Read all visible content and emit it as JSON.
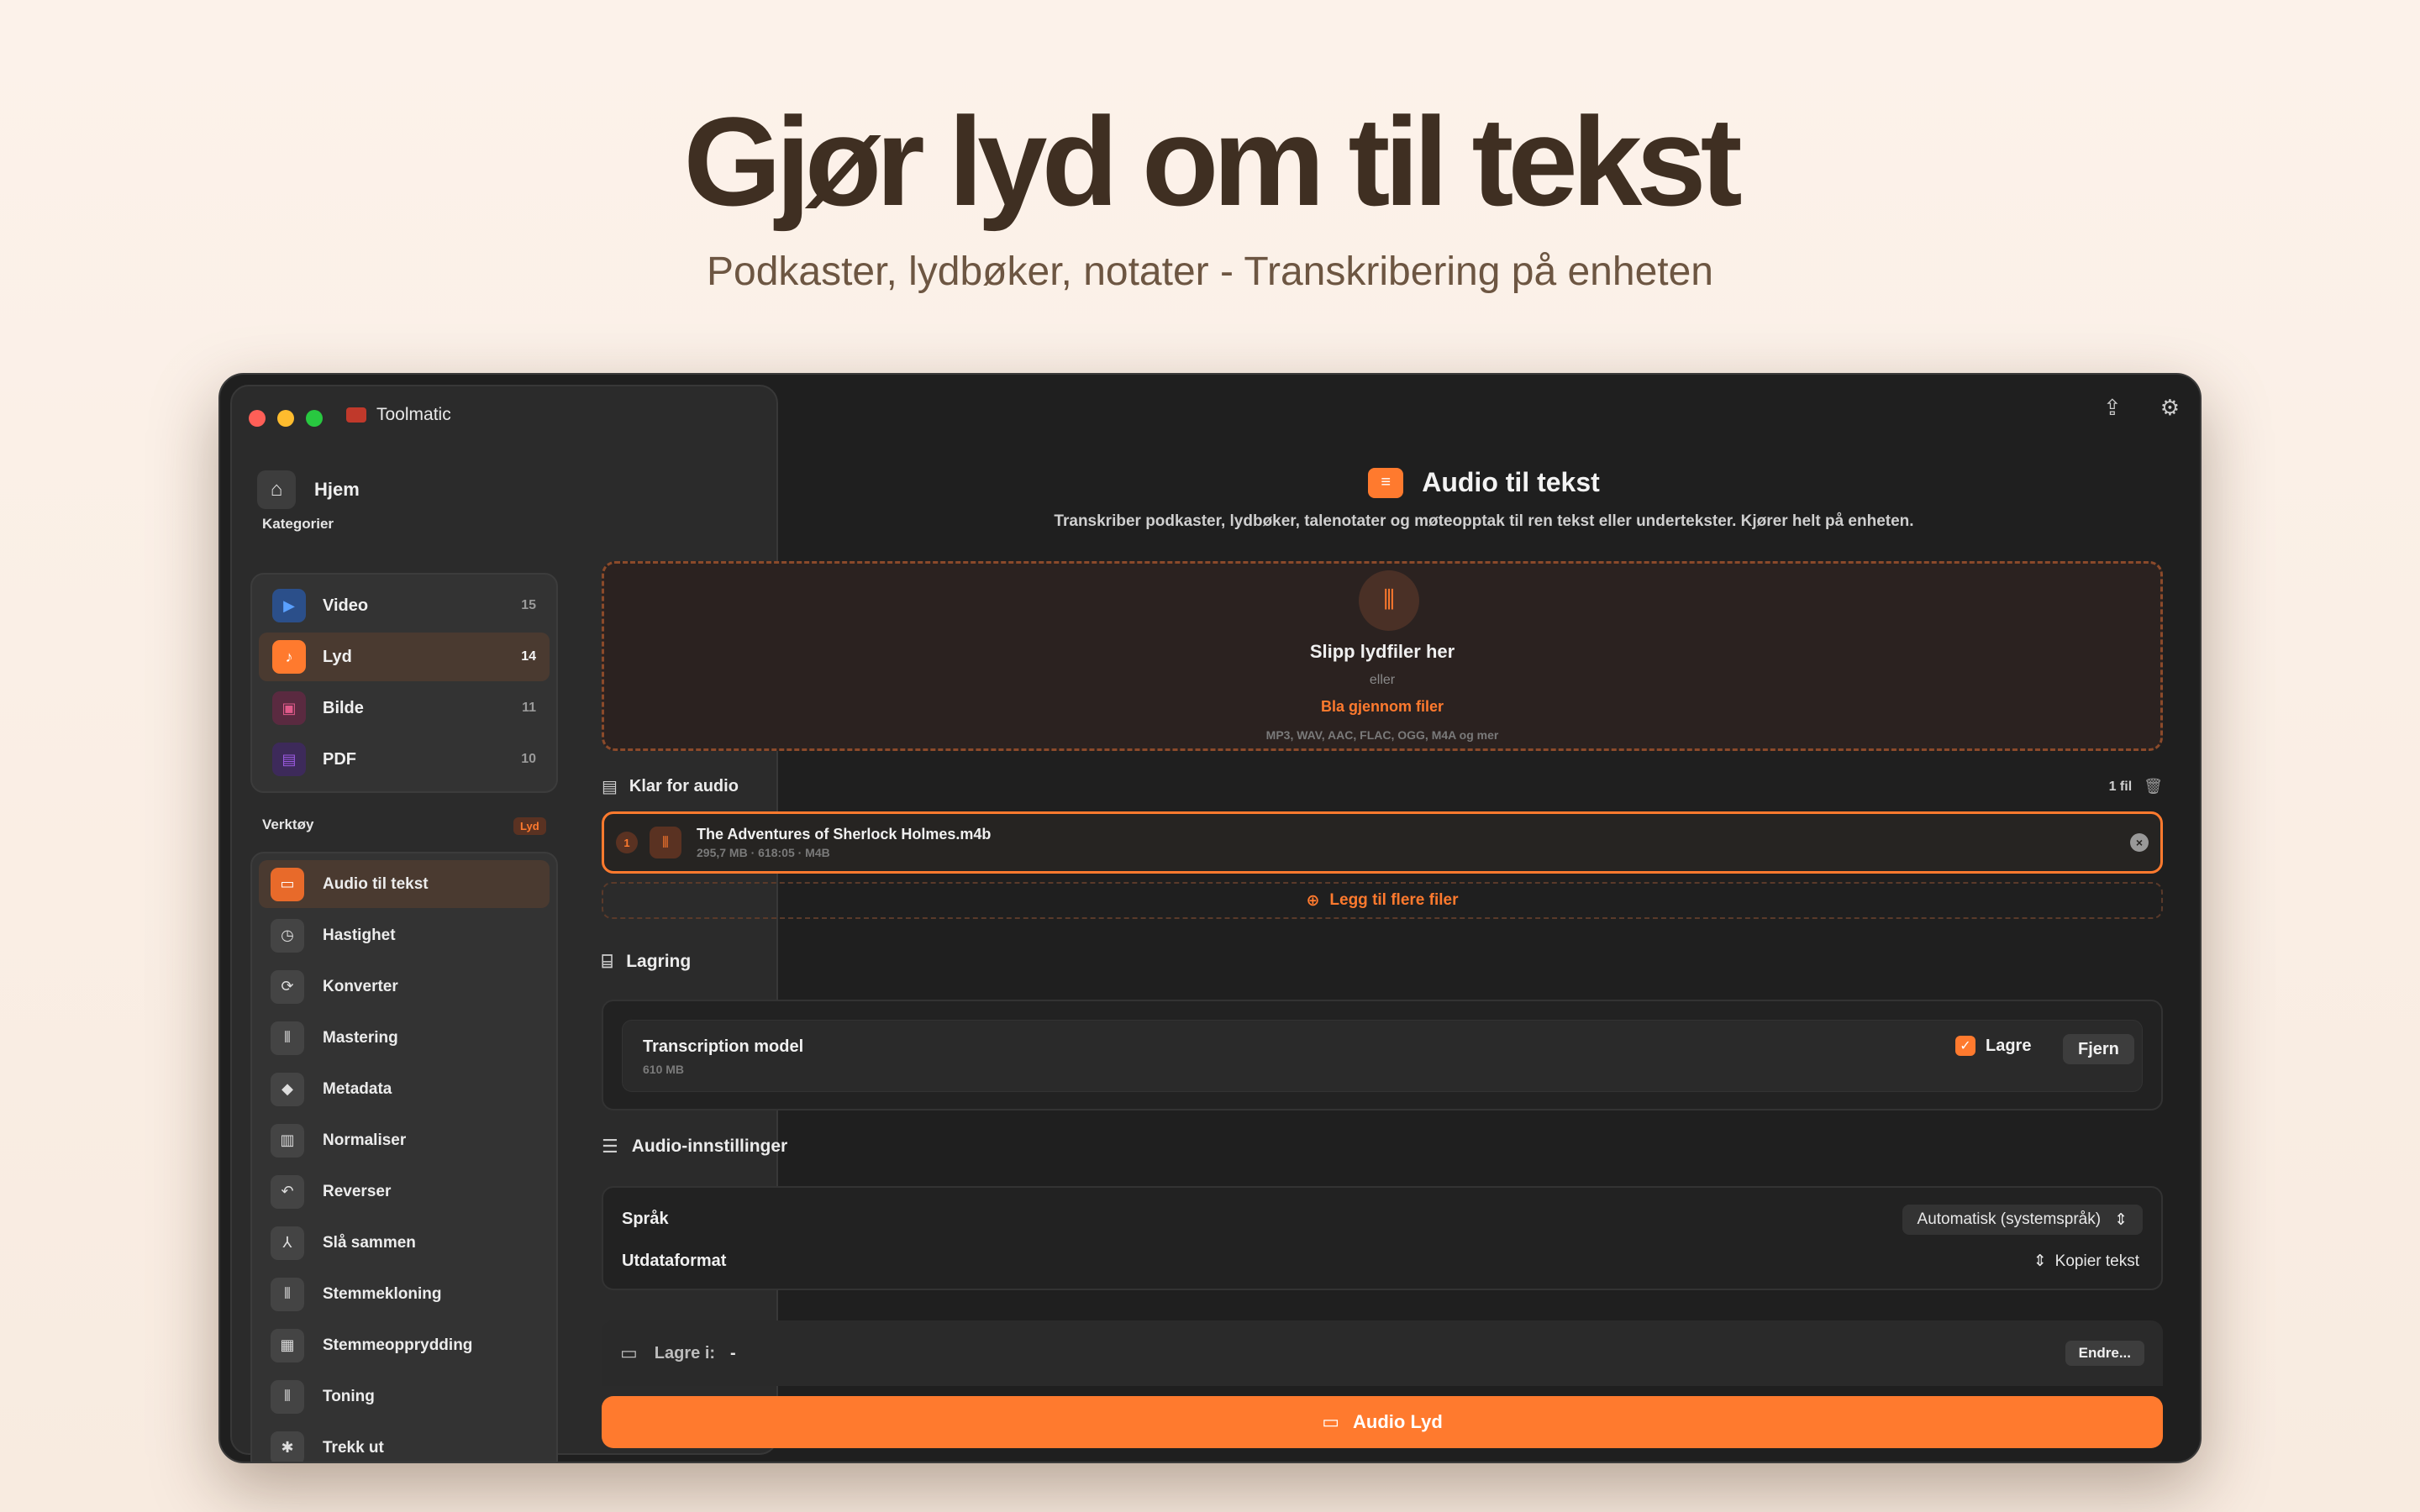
{
  "hero": {
    "title": "Gjør lyd om til tekst",
    "subtitle": "Podkaster, lydbøker, notater - Transkribering på enheten"
  },
  "window": {
    "app_name": "Toolmatic",
    "traffic_colors": [
      "#ff5f57",
      "#febc2e",
      "#28c840"
    ]
  },
  "sidebar": {
    "home_label": "Hjem",
    "categories_label": "Kategorier",
    "categories": [
      {
        "label": "Video",
        "count": "15",
        "color": "#2b6fd6",
        "icon": "play-icon"
      },
      {
        "label": "Lyd",
        "count": "14",
        "color": "#ff7a2e",
        "icon": "music-note-icon"
      },
      {
        "label": "Bilde",
        "count": "11",
        "color": "#b8336a",
        "icon": "image-icon"
      },
      {
        "label": "PDF",
        "count": "10",
        "color": "#7b3fc4",
        "icon": "document-icon"
      }
    ],
    "tools_label": "Verktøy",
    "tools_badge": "Lyd",
    "tools": [
      {
        "label": "Audio til tekst",
        "icon": "speech-bubble-icon"
      },
      {
        "label": "Hastighet",
        "icon": "speedometer-icon"
      },
      {
        "label": "Konverter",
        "icon": "convert-icon"
      },
      {
        "label": "Mastering",
        "icon": "waveform-icon"
      },
      {
        "label": "Metadata",
        "icon": "tag-icon"
      },
      {
        "label": "Normaliser",
        "icon": "level-icon"
      },
      {
        "label": "Reverser",
        "icon": "undo-icon"
      },
      {
        "label": "Slå sammen",
        "icon": "merge-icon"
      },
      {
        "label": "Stemmekloning",
        "icon": "voice-icon"
      },
      {
        "label": "Stemmeopprydding",
        "icon": "cleanup-icon"
      },
      {
        "label": "Toning",
        "icon": "tone-icon"
      },
      {
        "label": "Trekk ut",
        "icon": "extract-icon"
      }
    ]
  },
  "main": {
    "title": "Audio til tekst",
    "subtitle": "Transkriber podkaster, lydbøker, talenotater og møteopptak til ren tekst eller undertekster. Kjører helt på enheten.",
    "accent": "#ff7a2e",
    "dropzone": {
      "title": "Slipp lydfiler her",
      "or": "eller",
      "browse": "Bla gjennom filer",
      "formats": "MP3, WAV, AAC, FLAC, OGG, M4A og mer"
    },
    "ready": {
      "label": "Klar for audio",
      "count": "1 fil"
    },
    "file": {
      "index": "1",
      "name": "The Adventures of Sherlock Holmes.m4b",
      "meta": "295,7 MB · 618:05 · M4B"
    },
    "add_more": "Legg til flere filer",
    "storage": {
      "label": "Lagring",
      "model_name": "Transcription model",
      "model_size": "610 MB",
      "save_label": "Lagre",
      "remove_label": "Fjern"
    },
    "audio_settings": {
      "label": "Audio-innstillinger",
      "language_label": "Språk",
      "language_value": "Automatisk (systemspråk)",
      "format_label": "Utdataformat",
      "format_value": "Kopier tekst"
    },
    "save_to": {
      "label": "Lagre i:",
      "value": "-",
      "change_label": "Endre..."
    },
    "primary_action": "Audio Lyd"
  }
}
